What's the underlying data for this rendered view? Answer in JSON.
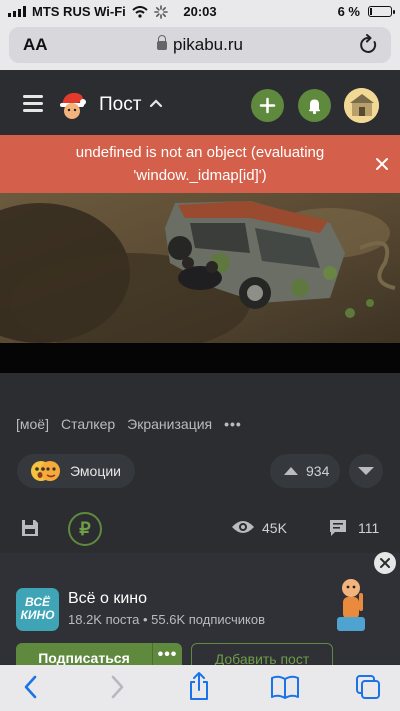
{
  "status_bar": {
    "carrier": "MTS RUS Wi-Fi",
    "time": "20:03",
    "battery": "6 %"
  },
  "browser": {
    "aa_label": "AA",
    "url": "pikabu.ru"
  },
  "header": {
    "title": "Пост"
  },
  "error": {
    "message_line1": "undefined is not an object (evaluating",
    "message_line2": "'window._idmap[id]')"
  },
  "tags": [
    "[моё]",
    "Сталкер",
    "Экранизация"
  ],
  "post": {
    "emotions_label": "Эмоции",
    "rating": "934",
    "donate_symbol": "₽",
    "views": "45K",
    "comments": "111"
  },
  "community": {
    "logo_text_line1": "ВСЁ",
    "logo_text_line2": "КИНО",
    "name": "Всё о кино",
    "stats": "18.2K поста • 55.6K подписчиков",
    "subscribe_label": "Подписаться",
    "add_post_label": "Добавить пост"
  },
  "colors": {
    "accent_green": "#5f8a3e",
    "error_red": "#d4604b",
    "background": "#2b2d31"
  }
}
